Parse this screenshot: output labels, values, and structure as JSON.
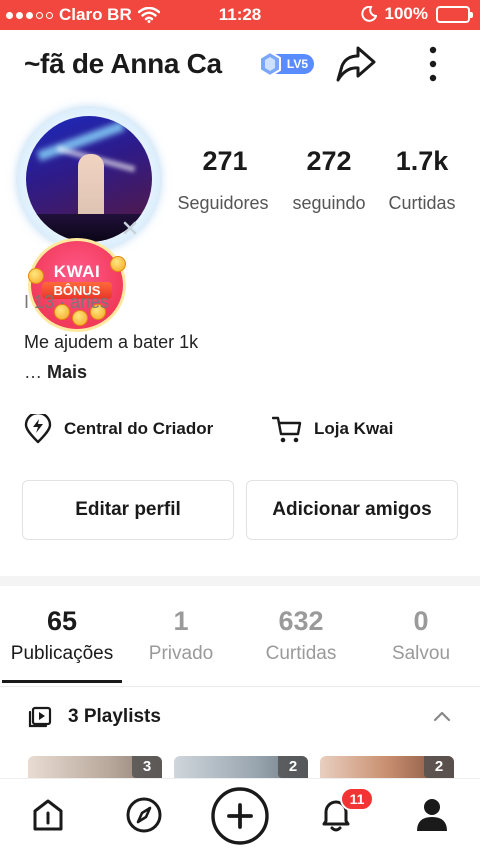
{
  "status_bar": {
    "carrier": "Claro BR",
    "time": "11:28",
    "battery": "100%"
  },
  "header": {
    "username": "~fã de Anna Ca",
    "level": "LV5",
    "share_icon": "share-arrow-icon",
    "more_icon": "more-vertical-icon"
  },
  "kwai_bonus": {
    "line1": "KWAI",
    "line2": "BÔNUS"
  },
  "stats": [
    {
      "value": "271",
      "label": "Seguidores"
    },
    {
      "value": "272",
      "label": "seguindo"
    },
    {
      "value": "1.7k",
      "label": "Curtidas"
    }
  ],
  "bio": {
    "info_line": "I    13  ·  aries",
    "text": "Me ajudem a bater 1k",
    "more_prefix": "… ",
    "more_label": "Mais"
  },
  "links": {
    "creator_center": "Central do Criador",
    "shop": "Loja Kwai"
  },
  "buttons": {
    "edit_profile": "Editar perfil",
    "add_friends": "Adicionar amigos"
  },
  "tabs": [
    {
      "count": "65",
      "label": "Publicações",
      "active": true
    },
    {
      "count": "1",
      "label": "Privado",
      "active": false
    },
    {
      "count": "632",
      "label": "Curtidas",
      "active": false
    },
    {
      "count": "0",
      "label": "Salvou",
      "active": false
    }
  ],
  "playlists": {
    "label": "3 Playlists",
    "items": [
      {
        "count": "3"
      },
      {
        "count": "2"
      },
      {
        "count": "2"
      }
    ]
  },
  "bottom_nav": {
    "items": [
      "home-icon",
      "discover-compass-icon",
      "create-plus-icon",
      "notifications-bell-icon",
      "profile-icon"
    ],
    "notification_count": "11"
  },
  "colors": {
    "status_bar": "#f2473e",
    "active_text": "#1a1a1a",
    "inactive_text": "#9a9a9a",
    "badge": "#f23434",
    "level_badge": "#5b8cff"
  }
}
